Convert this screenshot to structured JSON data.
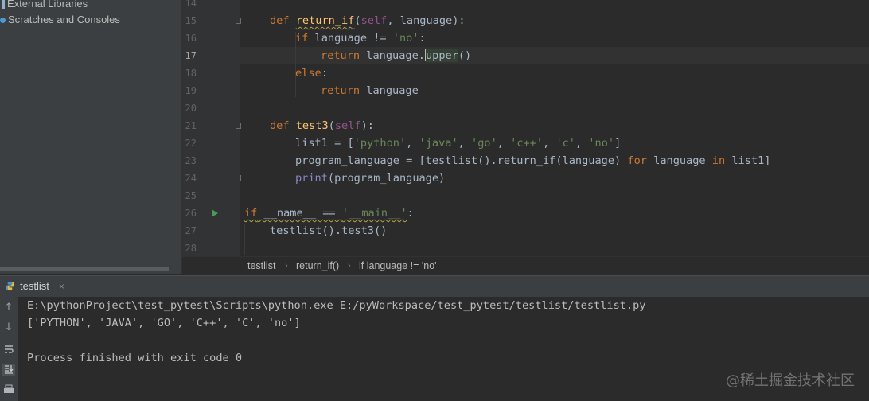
{
  "sidebar": {
    "items": [
      {
        "label": "External Libraries",
        "icon": "library-icon"
      },
      {
        "label": "Scratches and Consoles",
        "icon": "scratches-icon"
      }
    ]
  },
  "editor": {
    "current_line": 17,
    "lines": [
      {
        "num": "14"
      },
      {
        "num": "15"
      },
      {
        "num": "16"
      },
      {
        "num": "17"
      },
      {
        "num": "18"
      },
      {
        "num": "19"
      },
      {
        "num": "20"
      },
      {
        "num": "21"
      },
      {
        "num": "22"
      },
      {
        "num": "23"
      },
      {
        "num": "24"
      },
      {
        "num": "25"
      },
      {
        "num": "26"
      },
      {
        "num": "27"
      },
      {
        "num": "28"
      }
    ],
    "code": {
      "l15": {
        "kw": "def",
        "fn": "return_if",
        "self": "self",
        "rest": ", language):"
      },
      "l16": {
        "kw": "if",
        "a": " language != ",
        "str": "'no'",
        "b": ":"
      },
      "l17": {
        "kw": "return",
        "a": " language.",
        "m": "upper",
        "b": "()"
      },
      "l18": {
        "kw": "else",
        "a": ":"
      },
      "l19": {
        "kw": "return",
        "a": " language"
      },
      "l21": {
        "kw": "def",
        "fn": "test3",
        "self": "self",
        "rest": "):"
      },
      "l22": {
        "a": "list1 = [",
        "s1": "'python'",
        "s2": "'java'",
        "s3": "'go'",
        "s4": "'c++'",
        "s5": "'c'",
        "s6": "'no'",
        "sep": ", ",
        "b": "]"
      },
      "l23": {
        "a": "program_language = [testlist().return_if(language) ",
        "k1": "for",
        "m": " language ",
        "k2": "in",
        "b": " list1]"
      },
      "l24": {
        "bi": "print",
        "a": "(program_language)"
      },
      "l26": {
        "kw": "if",
        "a": " __name__ == ",
        "str": "'__main__'",
        "b": ":"
      },
      "l27": {
        "a": "testlist().test3()"
      }
    }
  },
  "breadcrumb": [
    "testlist",
    "return_if()",
    "if language != 'no'"
  ],
  "run_panel": {
    "tab_label": "testlist",
    "tab_close": "×",
    "toolbar_icons": [
      "up-arrow-icon",
      "down-arrow-icon",
      "soft-wrap-icon",
      "scroll-to-end-icon",
      "print-icon"
    ],
    "output": [
      "E:\\pythonProject\\test_pytest\\Scripts\\python.exe E:/pyWorkspace/test_pytest/testlist/testlist.py",
      "['PYTHON', 'JAVA', 'GO', 'C++', 'C', 'no']",
      "",
      "Process finished with exit code 0"
    ]
  },
  "watermark": "@稀土掘金技术社区",
  "colors": {
    "keyword": "#cc7832",
    "function": "#ffc66d",
    "self": "#94558d",
    "string": "#6a8759",
    "builtin": "#8888c6",
    "text": "#a9b7c6",
    "background": "#2b2b2b",
    "panel": "#3c3f41"
  }
}
